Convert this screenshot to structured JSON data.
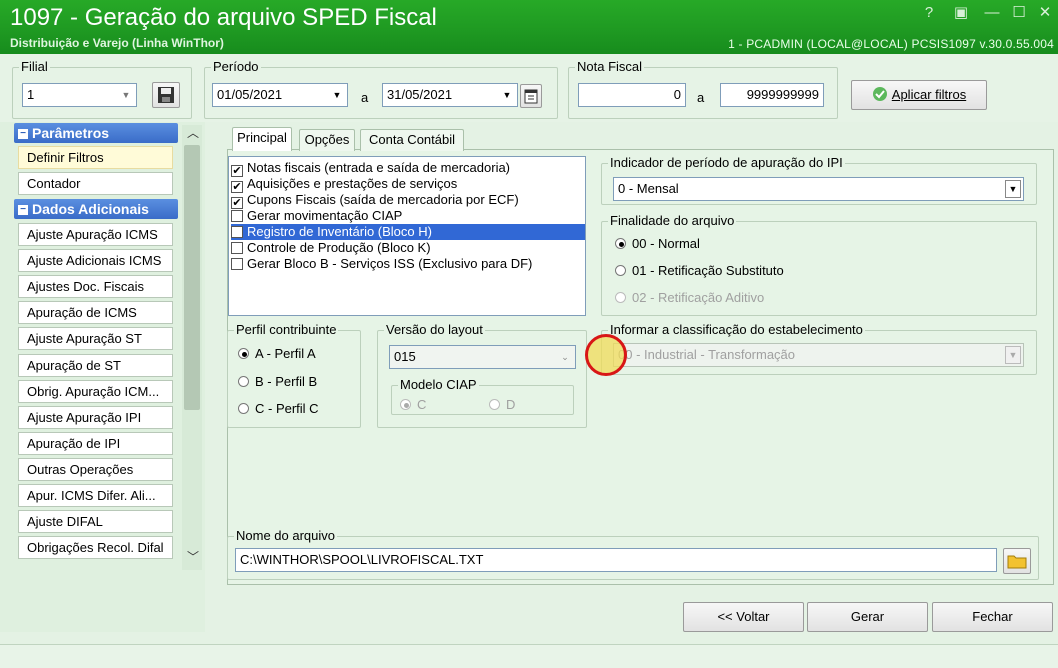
{
  "window": {
    "title": "1097 - Geração do arquivo SPED Fiscal",
    "subtitle": "Distribuição e Varejo (Linha WinThor)",
    "status": "1 - PCADMIN (LOCAL@LOCAL)   PCSIS1097  v.30.0.55.004",
    "help_glyph": "?",
    "min_glyph": "—",
    "max_glyph": "☐",
    "close_glyph": "✕"
  },
  "filters": {
    "filial_label": "Filial",
    "filial_value": "1",
    "periodo_label": "Período",
    "periodo_start": "01/05/2021",
    "periodo_sep": "a",
    "periodo_end": "31/05/2021",
    "nota_label": "Nota Fiscal",
    "nota_start": "0",
    "nota_sep": "a",
    "nota_end": "9999999999",
    "apply_label": "Aplicar filtros"
  },
  "sidebar": {
    "parametros_header": "Parâmetros",
    "dados_header": "Dados Adicionais",
    "param_items": [
      {
        "label": "Definir Filtros"
      },
      {
        "label": "Contador"
      }
    ],
    "dados_items": [
      {
        "label": "Ajuste Apuração ICMS"
      },
      {
        "label": "Ajuste Adicionais ICMS"
      },
      {
        "label": "Ajustes Doc. Fiscais"
      },
      {
        "label": "Apuração de ICMS"
      },
      {
        "label": "Ajuste Apuração ST"
      },
      {
        "label": "Apuração de ST"
      },
      {
        "label": "Obrig. Apuração ICM..."
      },
      {
        "label": "Ajuste Apuração IPI"
      },
      {
        "label": "Apuração de IPI"
      },
      {
        "label": "Outras Operações"
      },
      {
        "label": "Apur. ICMS Difer. Ali..."
      },
      {
        "label": "Ajuste DIFAL"
      },
      {
        "label": "Obrigações Recol. Difal"
      }
    ]
  },
  "tabs": [
    {
      "label": "Principal"
    },
    {
      "label": "Opções"
    },
    {
      "label": "Conta Contábil"
    }
  ],
  "checklist": [
    {
      "label": "Notas fiscais (entrada e saída de mercadoria)",
      "checked": true
    },
    {
      "label": "Aquisições e prestações de serviços",
      "checked": true
    },
    {
      "label": "Cupons Fiscais (saída de mercadoria por ECF)",
      "checked": true
    },
    {
      "label": "Gerar movimentação CIAP",
      "checked": false
    },
    {
      "label": "Registro de Inventário (Bloco H)",
      "checked": false
    },
    {
      "label": "Controle de Produção (Bloco K)",
      "checked": false
    },
    {
      "label": "Gerar Bloco B - Serviços ISS (Exclusivo para DF)",
      "checked": false
    }
  ],
  "ipi": {
    "label": "Indicador de período de apuração do IPI",
    "value": "0 - Mensal"
  },
  "finalidade": {
    "label": "Finalidade do arquivo",
    "options": [
      {
        "label": "00 - Normal",
        "selected": true,
        "enabled": true
      },
      {
        "label": "01 - Retificação Substituto",
        "selected": false,
        "enabled": true
      },
      {
        "label": "02 - Retificação Aditivo",
        "selected": false,
        "enabled": false
      }
    ]
  },
  "perfil": {
    "label": "Perfil contribuinte",
    "options": [
      {
        "label": "A - Perfil A",
        "selected": true
      },
      {
        "label": "B - Perfil B",
        "selected": false
      },
      {
        "label": "C - Perfil C",
        "selected": false
      }
    ]
  },
  "layout": {
    "label": "Versão do layout",
    "value": "015",
    "ciap_label": "Modelo CIAP",
    "ciap_c": "C",
    "ciap_d": "D"
  },
  "classificacao": {
    "label": "Informar a classificação do estabelecimento",
    "value": "00 - Industrial - Transformação"
  },
  "arquivo": {
    "label": "Nome do arquivo",
    "value": "C:\\WINTHOR\\SPOOL\\LIVROFISCAL.TXT"
  },
  "actions": {
    "back": "<< Voltar",
    "generate": "Gerar",
    "close": "Fechar"
  },
  "icons": {
    "save": "save-icon",
    "calendar": "calendar-icon",
    "apply": "check-circle-icon",
    "folder": "folder-icon"
  },
  "colors": {
    "titlebar": "#1f9a22",
    "selection": "#3168d5",
    "sidebar_header": "#3a6cc8"
  }
}
